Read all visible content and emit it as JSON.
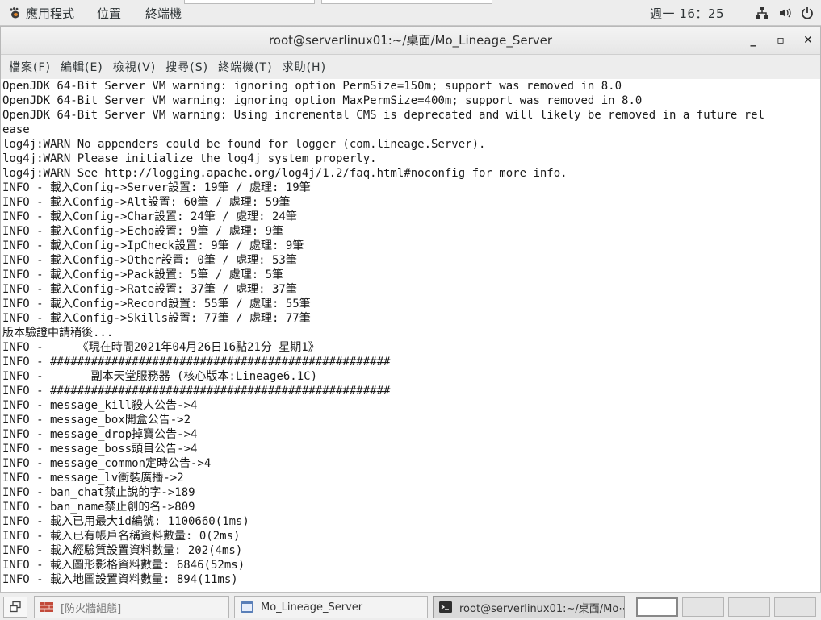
{
  "top_panel": {
    "applications": "應用程式",
    "places": "位置",
    "terminal": "終端機",
    "clock": "週一 16：25"
  },
  "window": {
    "title": "root@serverlinux01:~/桌面/Mo_Lineage_Server",
    "minimize": "_",
    "maximize": "▫",
    "close": "✕"
  },
  "menubar": {
    "items": [
      "檔案(F)",
      "編輯(E)",
      "檢視(V)",
      "搜尋(S)",
      "終端機(T)",
      "求助(H)"
    ]
  },
  "terminal_lines": [
    "OpenJDK 64-Bit Server VM warning: ignoring option PermSize=150m; support was removed in 8.0",
    "OpenJDK 64-Bit Server VM warning: ignoring option MaxPermSize=400m; support was removed in 8.0",
    "OpenJDK 64-Bit Server VM warning: Using incremental CMS is deprecated and will likely be removed in a future rel",
    "ease",
    "log4j:WARN No appenders could be found for logger (com.lineage.Server).",
    "log4j:WARN Please initialize the log4j system properly.",
    "log4j:WARN See http://logging.apache.org/log4j/1.2/faq.html#noconfig for more info.",
    "INFO - 載入Config->Server設置: 19筆 / 處理: 19筆",
    "INFO - 載入Config->Alt設置: 60筆 / 處理: 59筆",
    "INFO - 載入Config->Char設置: 24筆 / 處理: 24筆",
    "INFO - 載入Config->Echo設置: 9筆 / 處理: 9筆",
    "INFO - 載入Config->IpCheck設置: 9筆 / 處理: 9筆",
    "INFO - 載入Config->Other設置: 0筆 / 處理: 53筆",
    "INFO - 載入Config->Pack設置: 5筆 / 處理: 5筆",
    "INFO - 載入Config->Rate設置: 37筆 / 處理: 37筆",
    "INFO - 載入Config->Record設置: 55筆 / 處理: 55筆",
    "INFO - 載入Config->Skills設置: 77筆 / 處理: 77筆",
    "版本驗證中請稍後...",
    "INFO -     《現在時間2021年04月26日16點21分 星期1》",
    "INFO - ##################################################",
    "INFO -       副本天堂服務器 (核心版本:Lineage6.1C)",
    "INFO - ##################################################",
    "INFO - message_kill殺人公告->4",
    "INFO - message_box開盒公告->2",
    "INFO - message_drop掉寶公告->4",
    "INFO - message_boss頭目公告->4",
    "INFO - message_common定時公告->4",
    "INFO - message_lv衝裝廣播->2",
    "INFO - ban_chat禁止說的字->189",
    "INFO - ban_name禁止創的名->809",
    "INFO - 載入已用最大id編號: 1100660(1ms)",
    "INFO - 載入已有帳戶名稱資料數量: 0(2ms)",
    "INFO - 載入經驗質設置資料數量: 202(4ms)",
    "INFO - 載入圖形影格資料數量: 6846(52ms)",
    "INFO - 載入地圖設置資料數量: 894(11ms)"
  ],
  "taskbar": {
    "tasks": [
      {
        "label": "[防火牆組態]"
      },
      {
        "label": "Mo_Lineage_Server"
      },
      {
        "label": "root@serverlinux01:~/桌面/Mo⋯"
      }
    ]
  },
  "colors": {
    "panel_bg": "#ededed",
    "terminal_bg": "#ffffff",
    "terminal_fg": "#1a1a1a"
  }
}
